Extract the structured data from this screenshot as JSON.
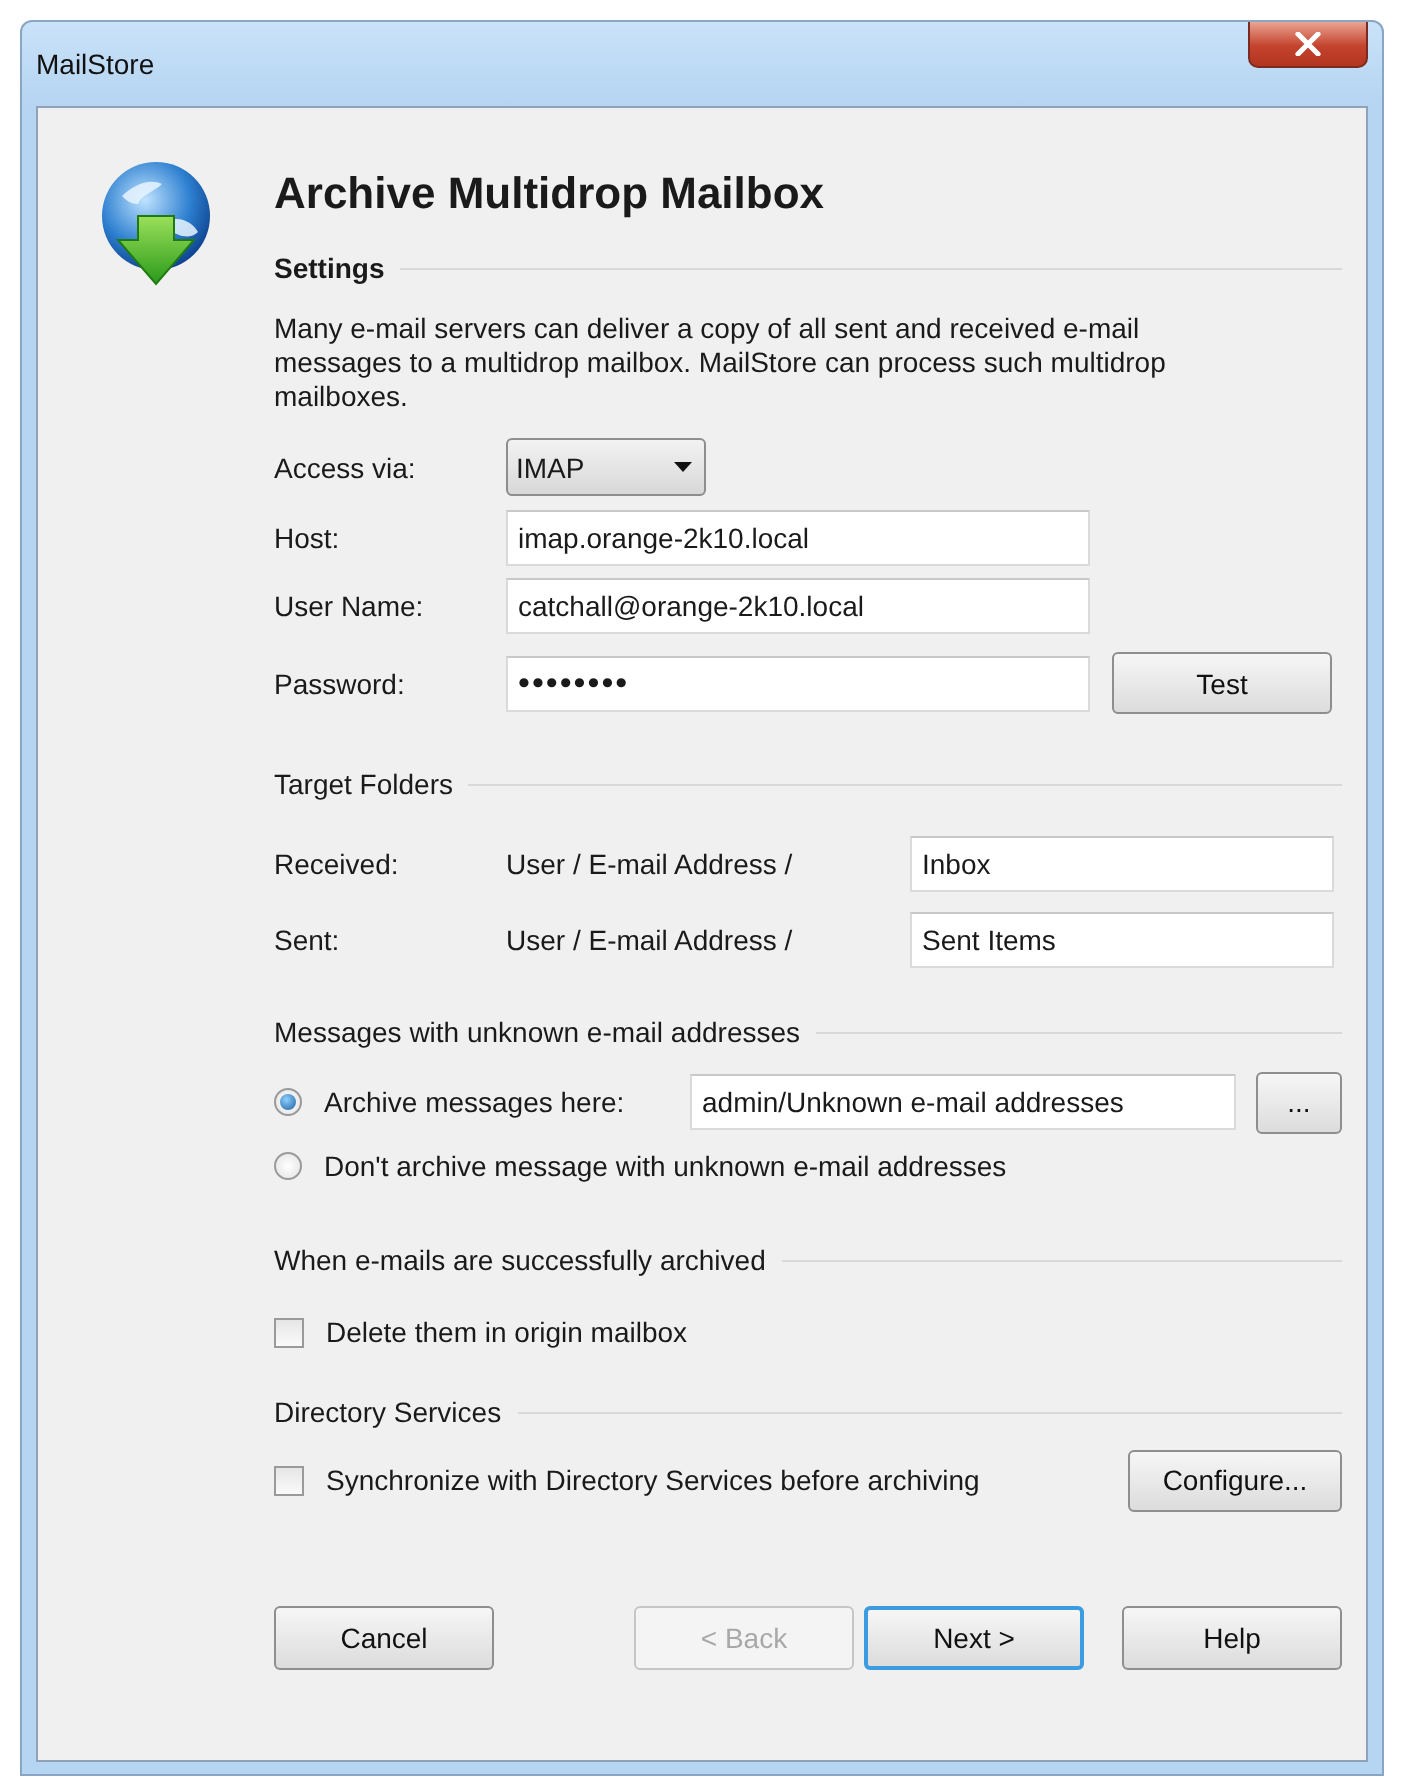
{
  "window": {
    "title": "MailStore"
  },
  "heading": "Archive Multidrop Mailbox",
  "settings": {
    "title": "Settings",
    "description": "Many e-mail servers can deliver a copy of all sent and received e-mail messages to a multidrop mailbox. MailStore can process such multidrop mailboxes.",
    "access_via": {
      "label": "Access via:",
      "value": "IMAP"
    },
    "host": {
      "label": "Host:",
      "value": "imap.orange-2k10.local"
    },
    "user_name": {
      "label": "User Name:",
      "value": "catchall@orange-2k10.local"
    },
    "password": {
      "label": "Password:",
      "value": "••••••••"
    },
    "test_button": "Test"
  },
  "target_folders": {
    "title": "Target Folders",
    "rows": [
      {
        "label": "Received:",
        "prefix": "User / E-mail Address /",
        "value": "Inbox"
      },
      {
        "label": "Sent:",
        "prefix": "User / E-mail Address /",
        "value": "Sent Items"
      }
    ]
  },
  "unknown_addresses": {
    "title": "Messages with unknown e-mail addresses",
    "options": [
      {
        "label": "Archive messages here:",
        "selected": true,
        "value": "admin/Unknown e-mail addresses",
        "browse_button": "..."
      },
      {
        "label": "Don't archive message with unknown e-mail addresses",
        "selected": false
      }
    ]
  },
  "after_archiving": {
    "title": "When e-mails are successfully archived",
    "checkbox": {
      "label": "Delete them in origin mailbox",
      "checked": false
    }
  },
  "directory_services": {
    "title": "Directory Services",
    "checkbox": {
      "label": "Synchronize with Directory Services before archiving",
      "checked": false
    },
    "button": "Configure..."
  },
  "buttons": [
    {
      "label": "Cancel",
      "disabled": false,
      "default": false
    },
    {
      "label": "< Back",
      "disabled": true,
      "default": false
    },
    {
      "label": "Next >",
      "disabled": false,
      "default": true
    },
    {
      "label": "Help",
      "disabled": false,
      "default": false
    }
  ]
}
